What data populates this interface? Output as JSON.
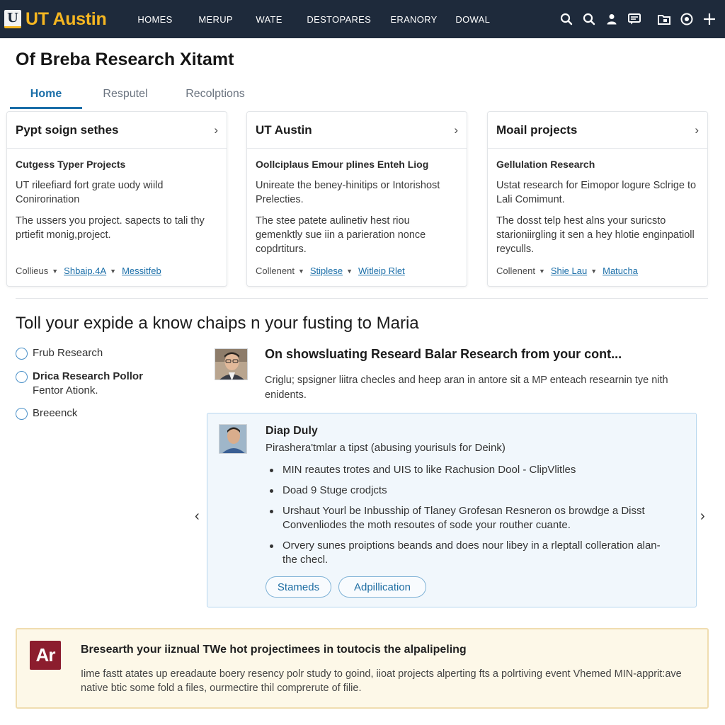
{
  "header": {
    "logo_mark": "U",
    "logo_text": "UT Austin",
    "nav": [
      "HOMES",
      "MERUP",
      "WATE",
      "DESTOPARES",
      "ERANORY",
      "DOWAL"
    ],
    "icons": [
      "search-icon",
      "search-icon",
      "user-icon",
      "message-icon",
      "folder-icon",
      "target-icon",
      "plus-icon"
    ],
    "accent": "#f5b621",
    "background": "#1e2a3b"
  },
  "page": {
    "title": "Of Breba Research Xitamt",
    "tabs": [
      "Home",
      "Resputel",
      "Recolptions"
    ],
    "accent": "#1a6ea8"
  },
  "cards": [
    {
      "title": "Pypt soign sethes",
      "subtitle": "Cutgess Typer Projects",
      "p1": "UT rileefiard fort grate uody wiild Conirorination",
      "p2": "The ussers you project. sapects to tali thy prtiefit monig,project.",
      "foot_label": "Collieus",
      "link1": "Shbaip.4A",
      "link2": "Messitfeb"
    },
    {
      "title": "UT Austin",
      "subtitle": "Oollciplaus Emour plines Enteh Liog",
      "p1": "Unireate the beney-hinitips or Intorishost Prelecties.",
      "p2": "The stee patete aulinetiv hest riou gemenktly sue iin a parieration nonce copdrtiturs.",
      "foot_label": "Collenent",
      "link1": "Stiplese",
      "link2": "Witleip Rlet"
    },
    {
      "title": "Moail projects",
      "subtitle": "Gellulation Research",
      "p1": "Ustat research for Eimopor logure Sclrige to Lali Comimunt.",
      "p2": "The dosst telp hest alns your suricsto starioniirgling it sen a hey hlotie enginpatioll reyculls.",
      "foot_label": "Collenent",
      "link1": "Shie Lau",
      "link2": "Matucha"
    }
  ],
  "section": {
    "heading": "Toll your expide a know chaips n your fusting to Maria"
  },
  "filters": [
    {
      "label": "Frub Research",
      "sub": ""
    },
    {
      "label": "Drica Research Pollor",
      "sub": "Fentor Ationk."
    },
    {
      "label": "Breeenck",
      "sub": ""
    }
  ],
  "post": {
    "title": "On showsluating Researd Balar Research from your cont...",
    "text": "Criglu; spsigner liitra checles and heep aran in antore sit a MP enteach researnin tye nith enidents."
  },
  "panel": {
    "name": "Diap Duly",
    "role": "Pirashera'tmlar a tipst (abusing yourisuls for Deink)",
    "bullets": [
      "MIN reautes trotes and UIS to like Rachusion Dool - ClipVlitles",
      "Doad 9 Stuge crodjcts",
      "Urshaut Yourl be Inbusship of Tlaney Grofesan Resneron os browdge a Disst Convenliodes the moth resoutes of sode your routher cuante.",
      "Orvery sunes proiptions beands and does nour libey in a rleptall colleration alan-the checl."
    ],
    "btn1": "Stameds",
    "btn2": "Adpillication",
    "prev": "‹",
    "next": "›"
  },
  "banner": {
    "logo": "Ar",
    "title": "Bresearth your iiznual TWe hot projectimees in toutocis the alpalipeling",
    "text": "Iime fastt atates up ereadaute boery resency polr study to goind, iioat projects alperting fts a polrtiving event Vhemed MIN-apprit:ave native btic some fold a files, ourmectire thil comprerute of filie.",
    "accent": "#8c1d2e"
  }
}
